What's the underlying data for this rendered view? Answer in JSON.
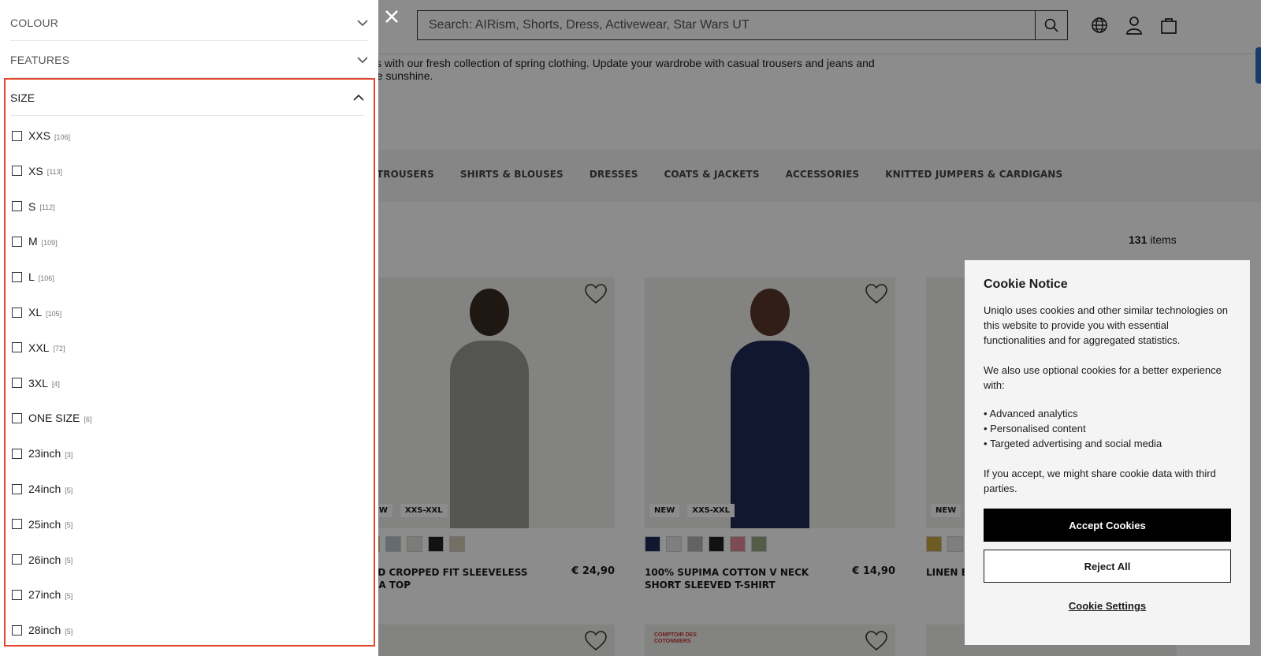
{
  "header": {
    "search_placeholder": "Search: AIRism, Shorts, Dress, Activewear, Star Wars UT",
    "icons": [
      "search-icon",
      "globe-icon",
      "account-icon",
      "bag-icon"
    ]
  },
  "intro": {
    "line1": "ys with our fresh collection of spring clothing. Update your wardrobe with casual trousers and jeans and",
    "line2": "he sunshine."
  },
  "categories": [
    "TROUSERS",
    "SHIRTS & BLOUSES",
    "DRESSES",
    "COATS & JACKETS",
    "ACCESSORIES",
    "KNITTED JUMPERS & CARDIGANS"
  ],
  "results": {
    "count": "131",
    "unit": "items"
  },
  "products": [
    {
      "name": "BED CROPPED FIT SLEEVELESS BRA TOP",
      "price": "€ 24,90",
      "badges": [
        "EW",
        "XXS-XXL"
      ],
      "swatch_colors": [
        "#d4c16a",
        "#b8c4cf",
        "#e2e2dc",
        "#222222",
        "#d8c9b3"
      ]
    },
    {
      "name": "100% SUPIMA COTTON V NECK SHORT SLEEVED T-SHIRT",
      "price": "€ 14,90",
      "badges": [
        "NEW",
        "XXS-XXL"
      ],
      "swatch_colors": [
        "#1f2a55",
        "#e8e8e8",
        "#b5b5b5",
        "#222222",
        "#e38a95",
        "#9aa783"
      ]
    },
    {
      "name": "LINEN BL",
      "price": "",
      "badges": [
        "NEW"
      ],
      "swatch_colors": [
        "#c9a640",
        "#e6e6e6"
      ]
    }
  ],
  "row2": {
    "label": "COMPTOIR DES COTONNIERS"
  },
  "filter": {
    "colour_label": "COLOUR",
    "features_label": "FEATURES",
    "size_label": "SIZE",
    "size_options": [
      {
        "name": "XXS",
        "count": "[106]"
      },
      {
        "name": "XS",
        "count": "[113]"
      },
      {
        "name": "S",
        "count": "[112]"
      },
      {
        "name": "M",
        "count": "[109]"
      },
      {
        "name": "L",
        "count": "[106]"
      },
      {
        "name": "XL",
        "count": "[105]"
      },
      {
        "name": "XXL",
        "count": "[72]"
      },
      {
        "name": "3XL",
        "count": "[4]"
      },
      {
        "name": "ONE SIZE",
        "count": "[6]"
      },
      {
        "name": "23inch",
        "count": "[3]"
      },
      {
        "name": "24inch",
        "count": "[5]"
      },
      {
        "name": "25inch",
        "count": "[5]"
      },
      {
        "name": "26inch",
        "count": "[5]"
      },
      {
        "name": "27inch",
        "count": "[5]"
      },
      {
        "name": "28inch",
        "count": "[5]"
      }
    ]
  },
  "cookie": {
    "title": "Cookie Notice",
    "p1": "Uniqlo uses cookies and other similar technologies on this website to provide you with essential functionalities and for aggregated statistics.",
    "p2": "We also use optional cookies for a better experience with:",
    "bullets": [
      "Advanced analytics",
      "Personalised content",
      "Targeted advertising and social media"
    ],
    "p3": "If you accept, we might share cookie data with third parties.",
    "accept": "Accept Cookies",
    "reject": "Reject All",
    "settings": "Cookie Settings"
  },
  "colors": {
    "highlight": "#e2472f",
    "overlay": "rgba(0,0,0,0.45)"
  }
}
